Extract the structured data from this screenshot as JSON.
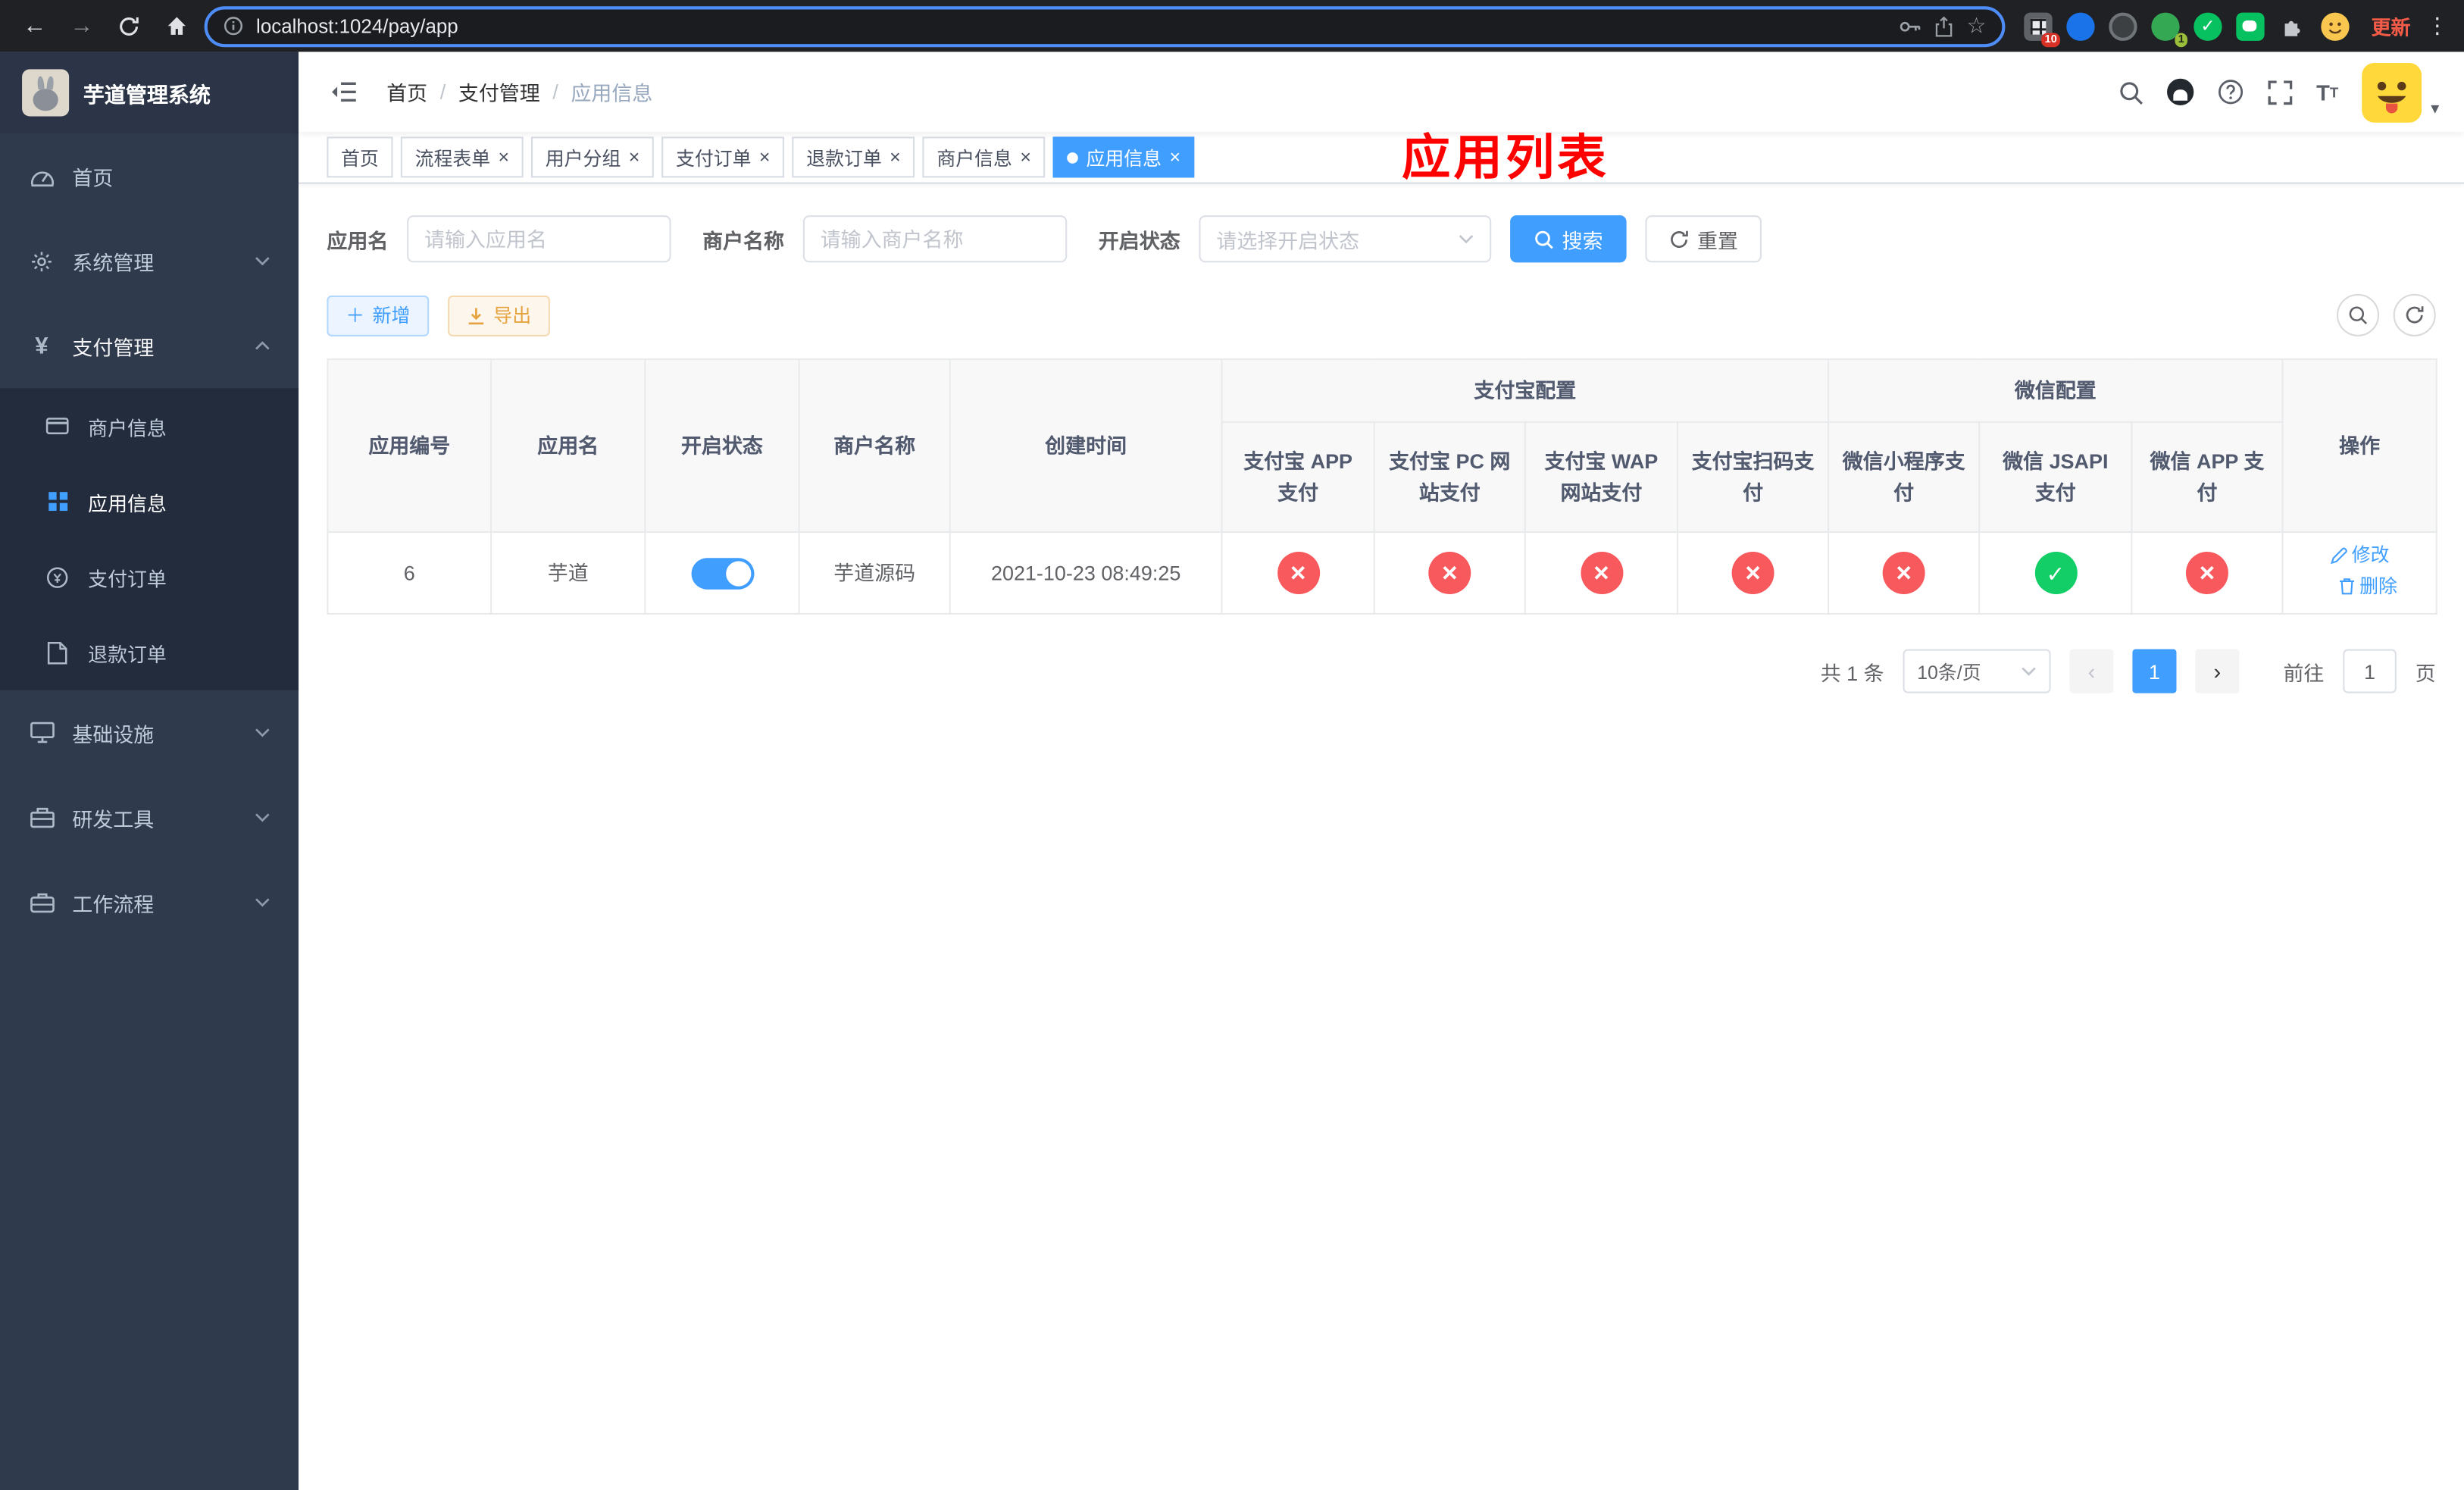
{
  "colors": {
    "accent": "#409eff",
    "danger": "#f56c6c",
    "success": "#13ce66",
    "warning": "#e6a23c",
    "overlay_red": "#ff0000",
    "sidebar_bg": "#2f3a4d"
  },
  "browser": {
    "url": "localhost:1024/pay/app",
    "update_button": "更新",
    "extensions_badge": "10",
    "profile_badge": "1"
  },
  "sidebar": {
    "logo_title": "芋道管理系统",
    "menu": [
      {
        "label": "首页"
      },
      {
        "label": "系统管理"
      },
      {
        "label": "支付管理"
      },
      {
        "label": "基础设施"
      },
      {
        "label": "研发工具"
      },
      {
        "label": "工作流程"
      }
    ],
    "submenu": [
      {
        "label": "商户信息"
      },
      {
        "label": "应用信息"
      },
      {
        "label": "支付订单"
      },
      {
        "label": "退款订单"
      }
    ]
  },
  "navbar": {
    "breadcrumb": {
      "home": "首页",
      "section": "支付管理",
      "current": "应用信息"
    }
  },
  "overlay": {
    "title": "应用列表"
  },
  "tabs": [
    {
      "label": "首页"
    },
    {
      "label": "流程表单"
    },
    {
      "label": "用户分组"
    },
    {
      "label": "支付订单"
    },
    {
      "label": "退款订单"
    },
    {
      "label": "商户信息"
    },
    {
      "label": "应用信息"
    }
  ],
  "filters": {
    "app_name_label": "应用名",
    "app_name_placeholder": "请输入应用名",
    "merchant_label": "商户名称",
    "merchant_placeholder": "请输入商户名称",
    "status_label": "开启状态",
    "status_placeholder": "请选择开启状态",
    "search_button": "搜索",
    "reset_button": "重置"
  },
  "toolbar": {
    "add_button": "新增",
    "export_button": "导出"
  },
  "table": {
    "headers": {
      "app_id": "应用编号",
      "app_name": "应用名",
      "status": "开启状态",
      "merchant": "商户名称",
      "created": "创建时间",
      "alipay_group": "支付宝配置",
      "wechat_group": "微信配置",
      "alipay_app": "支付宝 APP 支付",
      "alipay_pc": "支付宝 PC 网站支付",
      "alipay_wap": "支付宝 WAP 网站支付",
      "alipay_qr": "支付宝扫码支付",
      "wechat_mini": "微信小程序支付",
      "wechat_jsapi": "微信 JSAPI 支付",
      "wechat_app": "微信 APP 支付",
      "actions": "操作"
    },
    "rows": [
      {
        "app_id": "6",
        "app_name": "芋道",
        "status": "on",
        "merchant": "芋道源码",
        "created": "2021-10-23 08:49:25",
        "alipay_app": "disabled",
        "alipay_pc": "disabled",
        "alipay_wap": "disabled",
        "alipay_qr": "disabled",
        "wechat_mini": "disabled",
        "wechat_jsapi": "enabled",
        "wechat_app": "disabled",
        "edit": "修改",
        "delete": "删除"
      }
    ]
  },
  "pagination": {
    "total": "共 1 条",
    "page_size": "10条/页",
    "page": "1",
    "goto_label": "前往",
    "goto_value": "1",
    "goto_unit": "页"
  }
}
